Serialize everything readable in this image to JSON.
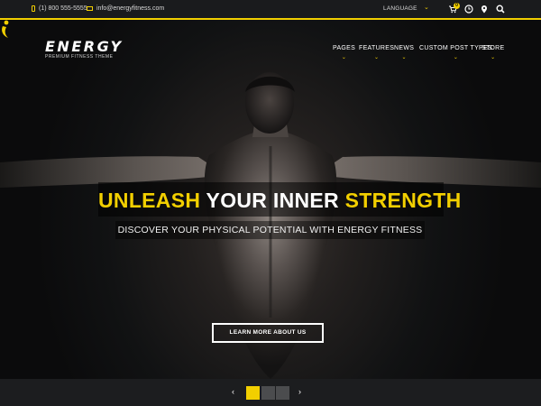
{
  "topbar": {
    "phone": "(1) 800 555-5555",
    "email": "info@energyfitness.com",
    "language_label": "LANGUAGE",
    "cart_count": "0",
    "accent": "#f2cf00"
  },
  "brand": {
    "name": "ENERGY",
    "tagline": "PREMIUM FITNESS THEME"
  },
  "nav": {
    "items": [
      {
        "label": "PAGES"
      },
      {
        "label": "FEATURES"
      },
      {
        "label": "NEWS"
      },
      {
        "label": "CUSTOM POST TYPES"
      },
      {
        "label": "STORE"
      }
    ]
  },
  "hero": {
    "headline": {
      "part1": "UNLEASH",
      "part2": " YOUR INNER ",
      "part3": "STRENGTH"
    },
    "subheadline": "DISCOVER YOUR PHYSICAL POTENTIAL WITH ENERGY FITNESS",
    "cta_label": "LEARN MORE ABOUT US"
  },
  "slider": {
    "prev_glyph": "‹",
    "next_glyph": "›",
    "active_index": 0,
    "slide_count": 3
  },
  "icons": {
    "phone": "phone-icon",
    "mail": "mail-icon",
    "cart": "cart-icon",
    "clock": "clock-icon",
    "location": "map-pin-icon",
    "search": "search-icon"
  }
}
